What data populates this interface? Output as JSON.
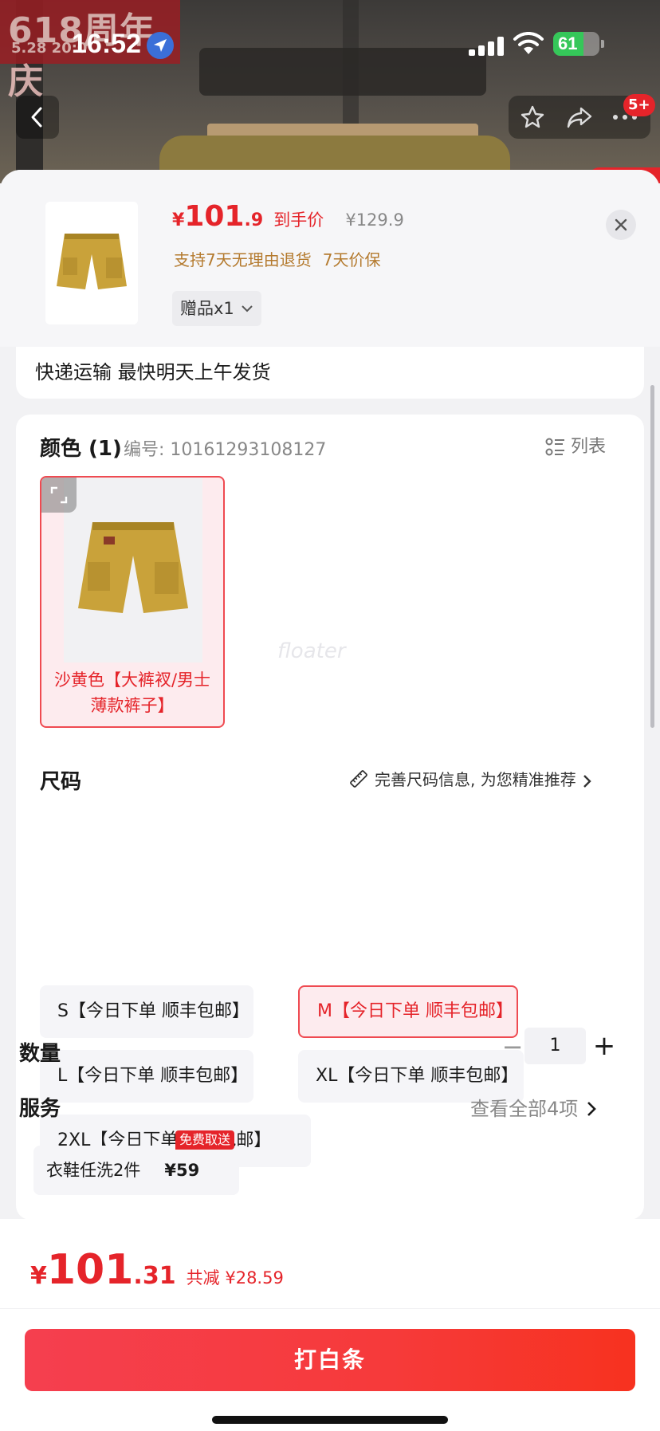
{
  "status_bar": {
    "time": "16:52",
    "battery": "61"
  },
  "background": {
    "promo_badge_title": "618周年庆",
    "promo_badge_date": "5.28 20:0",
    "message_badge": "5+"
  },
  "header": {
    "currency": "¥",
    "price_int": "101",
    "price_dec": ".9",
    "price_label": "到手价",
    "original_price": "¥129.9",
    "policy_return": "支持7天无理由退货",
    "policy_price": "7天价保",
    "gift_label": "赠品x1"
  },
  "shipping": {
    "text": "快递运输 最快明天上午发货"
  },
  "color_section": {
    "title": "颜色 (1)",
    "code_label": "编号: 10161293108127",
    "list_toggle": "列表",
    "swatch_label": "沙黄色【大裤衩/男士薄款裤子】",
    "watermark": "floater"
  },
  "size_section": {
    "title": "尺码",
    "hint": "完善尺码信息, 为您精准推荐",
    "options": [
      {
        "label": "S【今日下单 顺丰包邮】",
        "selected": false
      },
      {
        "label": "M【今日下单 顺丰包邮】",
        "selected": true
      },
      {
        "label": "L【今日下单 顺丰包邮】",
        "selected": false
      },
      {
        "label": "XL【今日下单 顺丰包邮】",
        "selected": false
      },
      {
        "label": "2XL【今日下单 顺丰包邮】",
        "selected": false
      }
    ]
  },
  "quantity": {
    "title": "数量",
    "minus": "−",
    "value": "1",
    "plus": "+"
  },
  "service": {
    "title": "服务",
    "more": "查看全部4项",
    "item_label": "衣鞋任洗2件",
    "item_price": "¥59",
    "item_tag": "免费取送"
  },
  "bottom": {
    "currency": "¥",
    "total_int": "101",
    "total_dec": ".31",
    "discount": "共减 ¥28.59",
    "cta": "打白条"
  },
  "colors": {
    "accent": "#e5242a",
    "gold": "#b47a2e",
    "chip_bg": "#f5f5f8"
  }
}
